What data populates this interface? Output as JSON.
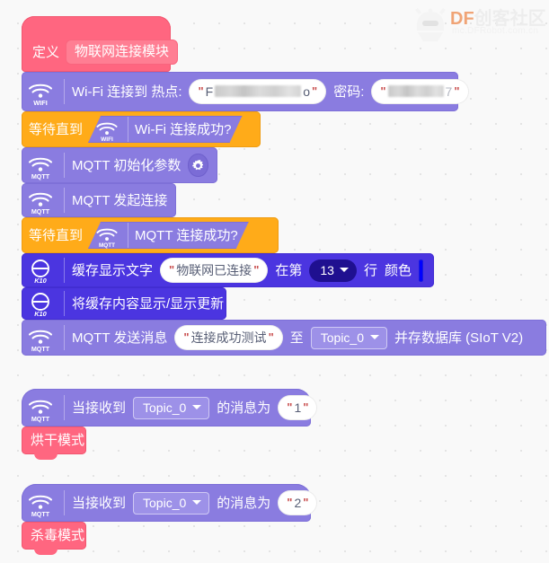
{
  "watermark": {
    "brand_df": "DF",
    "brand_cn": "创客社区",
    "url": "mc.DFRobot.com.cn",
    "robot_icon": "dfrobot-logo-icon"
  },
  "theme": {
    "background": "#f9f9f9",
    "grid_dot": "#e4e4e4",
    "pink_block": "#ff6680",
    "purple_block": "#8a7ce0",
    "indigo_block": "#4b35e0",
    "orange_block": "#ffab19",
    "dropdown_dark": "#1f1090",
    "color_value": "#0000ff"
  },
  "script_main": {
    "define_block": {
      "keyword": "定义",
      "procedure_name": "物联网连接模块"
    },
    "wifi_connect": {
      "icon": "wifi-icon",
      "icon_label": "WIFI",
      "text_before": "Wi-Fi 连接到 热点:",
      "ssid_prefix": "F",
      "ssid_suffix": "o",
      "ssid_redacted": true,
      "label_password": "密码:",
      "password_suffix": "7",
      "password_redacted": true
    },
    "wait_wifi": {
      "wait_label": "等待直到",
      "icon": "wifi-icon",
      "icon_label": "WIFI",
      "condition": "Wi-Fi 连接成功?"
    },
    "mqtt_init": {
      "icon": "mqtt-icon",
      "icon_label": "MQTT",
      "text": "MQTT 初始化参数",
      "settings_icon": "gear-icon"
    },
    "mqtt_connect": {
      "icon": "mqtt-icon",
      "icon_label": "MQTT",
      "text": "MQTT 发起连接"
    },
    "wait_mqtt": {
      "wait_label": "等待直到",
      "icon": "mqtt-icon",
      "icon_label": "MQTT",
      "condition": "MQTT 连接成功?"
    },
    "cache_display_text": {
      "icon": "k10-icon",
      "icon_label": "K10",
      "text_before": "缓存显示文字",
      "display_text": "物联网已连接",
      "text_mid": "在第",
      "line_number": "13",
      "text_after_line": "行",
      "label_color": "颜色",
      "color_value": "#0000ff"
    },
    "cache_refresh": {
      "icon": "k10-icon",
      "icon_label": "K10",
      "text": "将缓存内容显示/显示更新"
    },
    "mqtt_send": {
      "icon": "mqtt-icon",
      "icon_label": "MQTT",
      "text_before": "MQTT 发送消息",
      "message": "连接成功测试",
      "text_to": "至",
      "topic": "Topic_0",
      "text_after": "并存数据库 (SIoT V2)"
    }
  },
  "script_receive_1": {
    "hat": {
      "icon": "mqtt-icon",
      "icon_label": "MQTT",
      "text_before": "当接收到",
      "topic": "Topic_0",
      "text_mid": "的消息为",
      "value": "1"
    },
    "call_block": {
      "procedure_name": "烘干模式"
    }
  },
  "script_receive_2": {
    "hat": {
      "icon": "mqtt-icon",
      "icon_label": "MQTT",
      "text_before": "当接收到",
      "topic": "Topic_0",
      "text_mid": "的消息为",
      "value": "2"
    },
    "call_block": {
      "procedure_name": "杀毒模式"
    }
  }
}
